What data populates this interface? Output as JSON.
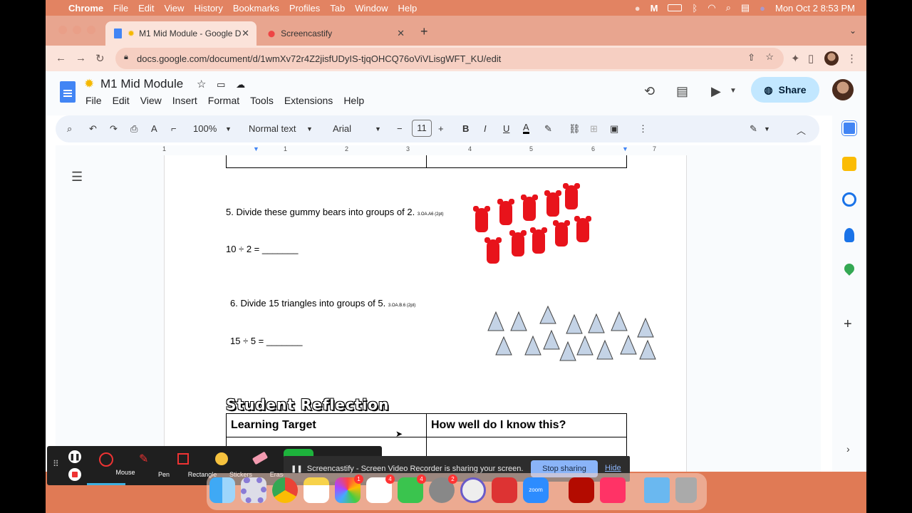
{
  "menubar": {
    "items": [
      "Chrome",
      "File",
      "Edit",
      "View",
      "History",
      "Bookmarks",
      "Profiles",
      "Tab",
      "Window",
      "Help"
    ],
    "clock": "Mon Oct 2  8:53 PM"
  },
  "tabs": [
    {
      "title": "M1 Mid Module - Google D"
    },
    {
      "title": "Screencastify"
    }
  ],
  "address": {
    "url": "docs.google.com/document/d/1wmXv72r4Z2jisfUDyIS-tjqOHCQ76oViVLisgWFT_KU/edit"
  },
  "doc": {
    "title": "M1 Mid Module",
    "menus": [
      "File",
      "Edit",
      "View",
      "Insert",
      "Format",
      "Tools",
      "Extensions",
      "Help"
    ],
    "share_label": "Share"
  },
  "toolbar": {
    "zoom": "100%",
    "style": "Normal text",
    "font": "Arial",
    "size": "11"
  },
  "ruler": {
    "marks": [
      "1",
      "1",
      "2",
      "3",
      "4",
      "5",
      "6",
      "7"
    ]
  },
  "content": {
    "q5": "5. Divide these gummy bears into groups of 2.",
    "q5_code": "3.OA.A6 (2pt)",
    "q5_eq": "10 ÷ 2 = _______",
    "q6": "6. Divide 15 triangles into groups of 5.",
    "q6_code": "3.OA.B.6 (2pt)",
    "q6_eq": "15 ÷ 5 = _______",
    "reflection_heading": "Student Reflection",
    "table_headers": [
      "Learning Target",
      "How well do I know this?"
    ]
  },
  "screencastify": {
    "tools": [
      "Mouse",
      "Pen",
      "Rectangle",
      "Stickers",
      "Eraser"
    ],
    "banner": "Screencastify - Screen Video Recorder is sharing your screen.",
    "stop": "Stop sharing",
    "hide": "Hide"
  },
  "dock": {
    "badges": [
      "1",
      "4",
      "4",
      "2"
    ]
  }
}
